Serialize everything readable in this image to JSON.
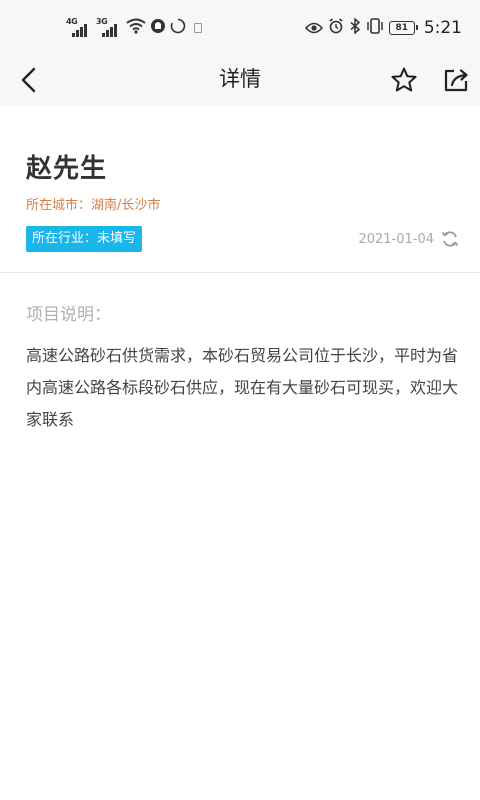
{
  "status_bar": {
    "network_1": "4G",
    "network_2": "3G",
    "battery": "81",
    "time": "5:21"
  },
  "header": {
    "title": "详情"
  },
  "contact": {
    "name": "赵先生",
    "city": "所在城市：湖南/长沙市",
    "industry": "所在行业：未填写",
    "date": "2021-01-04"
  },
  "description": {
    "label": "项目说明：",
    "text": "高速公路砂石供货需求，本砂石贸易公司位于长沙，平时为省内高速公路各标段砂石供应，现在有大量砂石可现买，欢迎大家联系"
  },
  "colors": {
    "badge_bg": "#1ab6ea",
    "city_text": "#d1804e",
    "header_bg": "#f7f7f7"
  },
  "icons": [
    "back-arrow-icon",
    "star-icon",
    "share-icon",
    "refresh-icon",
    "wifi-icon",
    "eye-icon",
    "alarm-icon",
    "bluetooth-icon",
    "vibrate-icon"
  ]
}
